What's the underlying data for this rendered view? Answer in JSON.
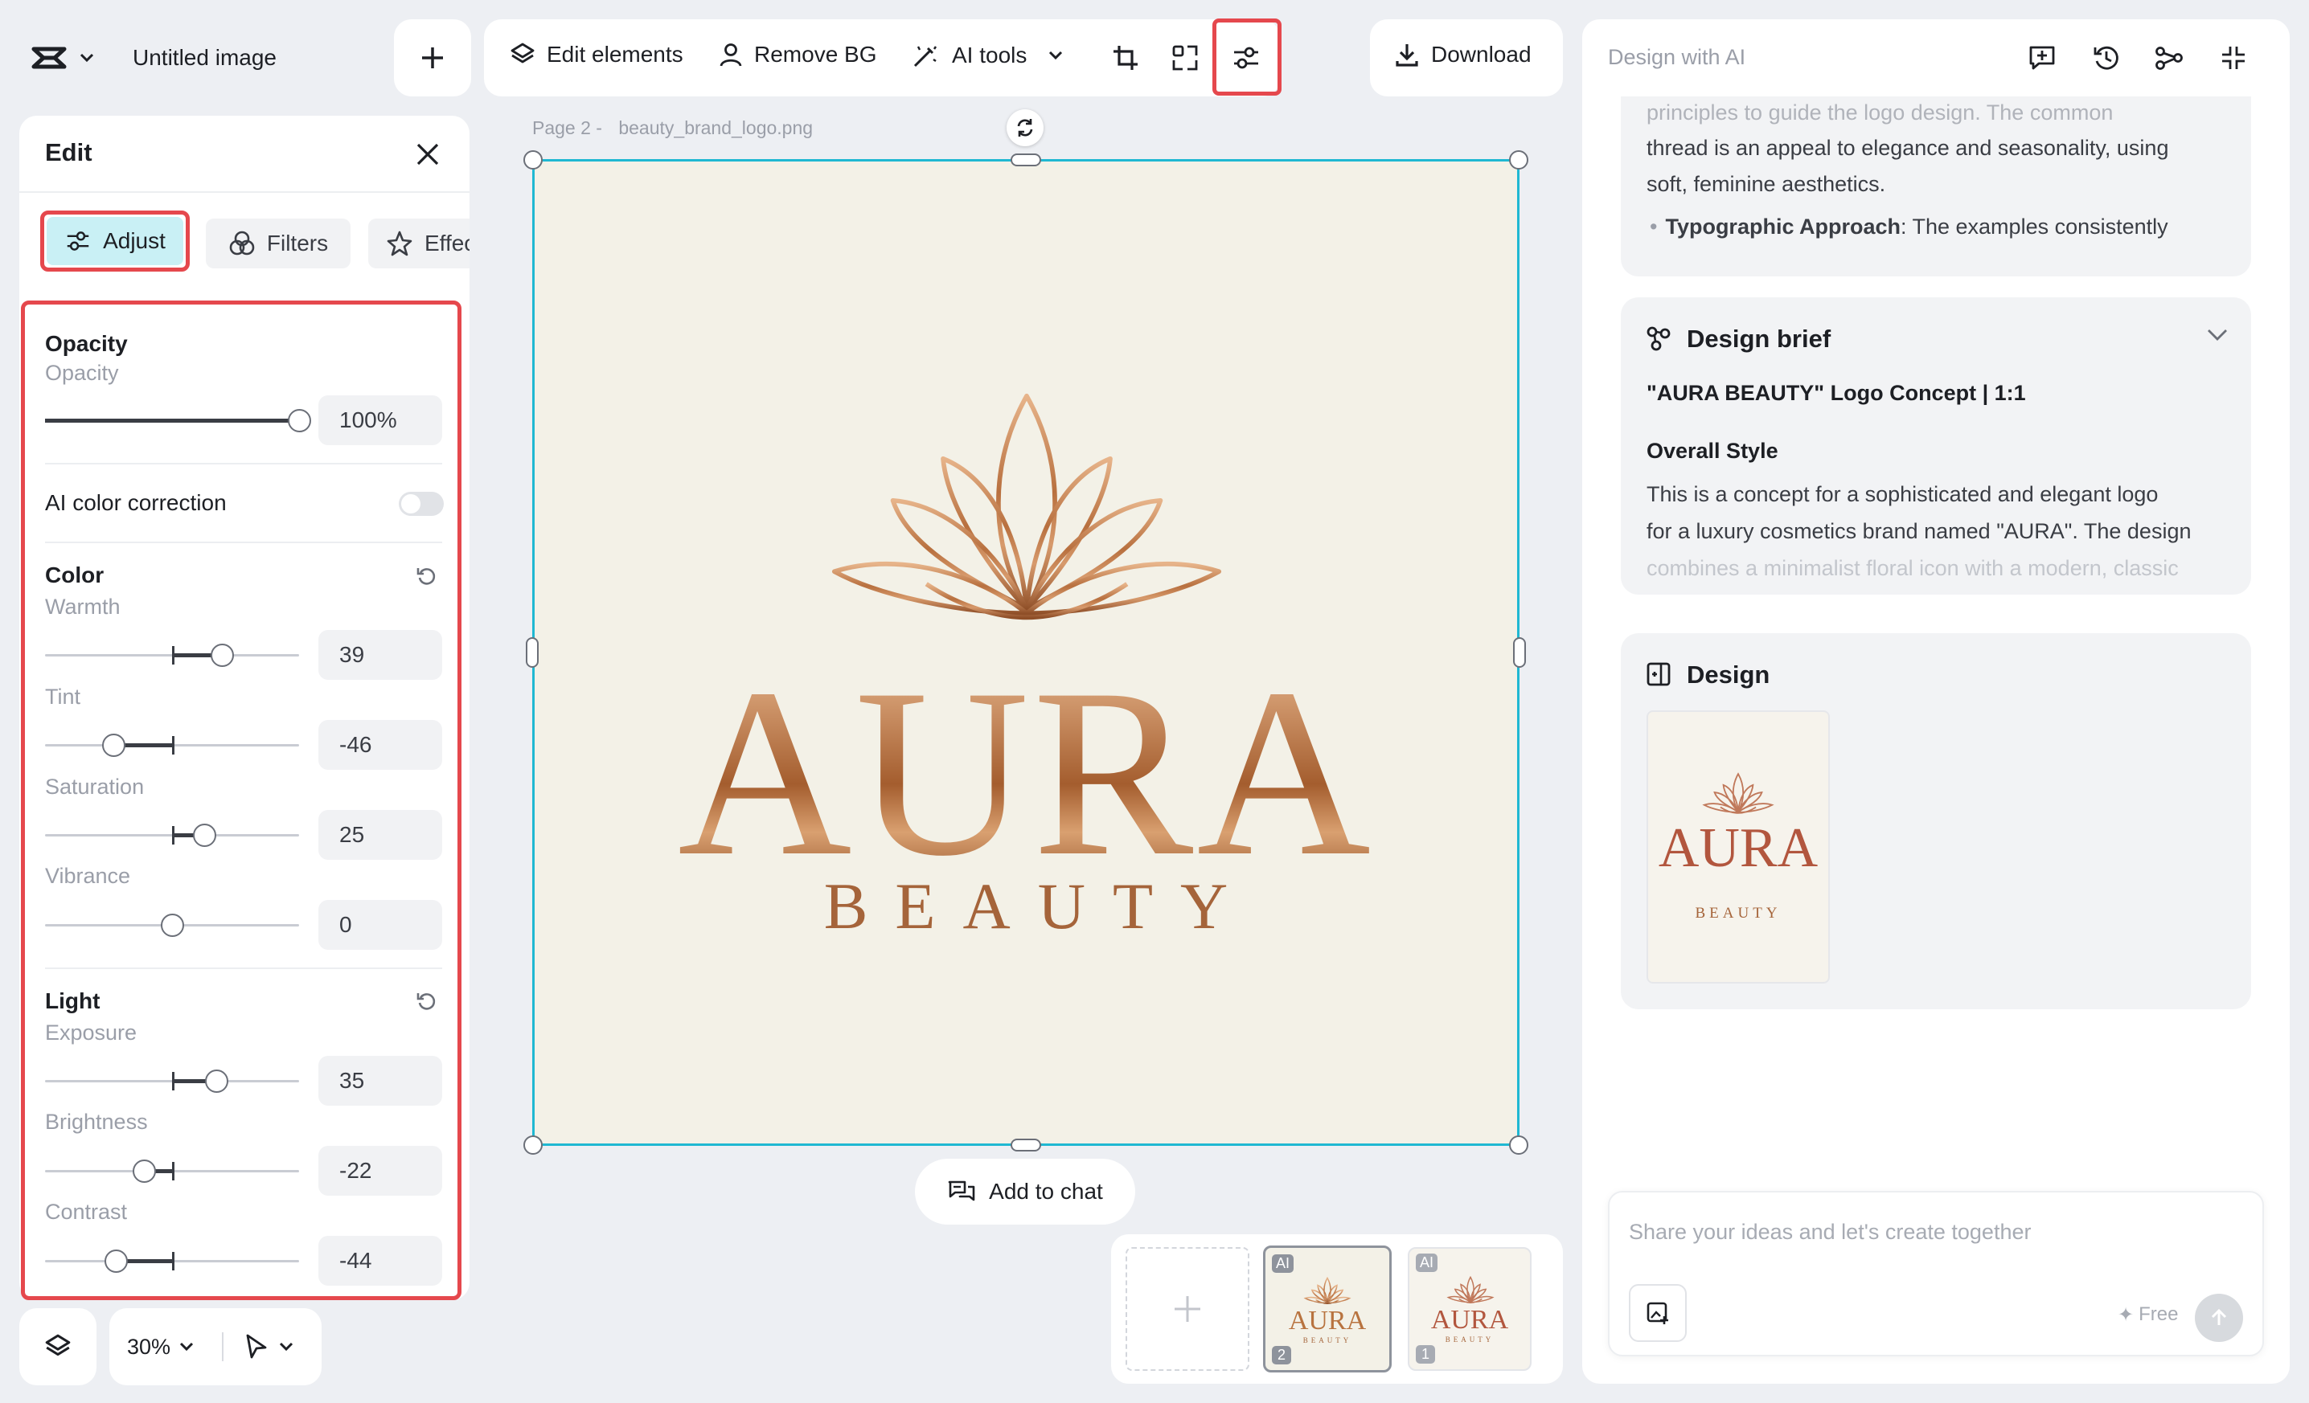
{
  "app": {
    "title": "Untitled image"
  },
  "toolbar": {
    "edit_elements": "Edit elements",
    "remove_bg": "Remove BG",
    "ai_tools": "AI tools",
    "download": "Download"
  },
  "edit_panel": {
    "title": "Edit",
    "tabs": [
      {
        "label": "Adjust",
        "active": true
      },
      {
        "label": "Filters",
        "active": false
      },
      {
        "label": "Effects",
        "active": false
      }
    ],
    "opacity": {
      "title": "Opacity",
      "label": "Opacity",
      "value": "100%",
      "level": 1.0
    },
    "ai_color_correction": {
      "label": "AI color correction",
      "enabled": false
    },
    "color": {
      "title": "Color",
      "sliders": [
        {
          "label": "Warmth",
          "value": "39"
        },
        {
          "label": "Tint",
          "value": "-46"
        },
        {
          "label": "Saturation",
          "value": "25"
        },
        {
          "label": "Vibrance",
          "value": "0"
        }
      ]
    },
    "light": {
      "title": "Light",
      "sliders": [
        {
          "label": "Exposure",
          "value": "35"
        },
        {
          "label": "Brightness",
          "value": "-22"
        },
        {
          "label": "Contrast",
          "value": "-44"
        }
      ]
    }
  },
  "bottom_left": {
    "zoom": "30%"
  },
  "canvas": {
    "page_label": "Page 2 -",
    "file_name": "beauty_brand_logo.png",
    "logo_title": "AURA",
    "logo_subtitle": "BEAUTY",
    "add_to_chat": "Add to chat"
  },
  "thumbnails": [
    {
      "badge": "AI",
      "number": "2",
      "title": "AURA",
      "subtitle": "BEAUTY",
      "selected": true
    },
    {
      "badge": "AI",
      "number": "1",
      "title": "AURA",
      "subtitle": "BEAUTY",
      "selected": false
    }
  ],
  "right_panel": {
    "title": "Design with AI",
    "summary_lines": [
      "principles to guide the logo design. The common",
      "thread is an appeal to elegance and seasonality, using",
      "soft, feminine aesthetics."
    ],
    "bullet_bold": "Typographic Approach",
    "bullet_rest": ": The examples consistently",
    "brief": {
      "title": "Design brief",
      "concept": "\"AURA BEAUTY\" Logo Concept | 1:1",
      "style_heading": "Overall Style",
      "lines": [
        "This is a concept for a sophisticated and elegant logo",
        "for a luxury cosmetics brand named \"AURA\". The design",
        "combines a minimalist floral icon with a modern, classic"
      ]
    },
    "design": {
      "title": "Design",
      "thumb_title": "AURA",
      "thumb_subtitle": "BEAUTY"
    },
    "chat": {
      "placeholder": "Share your ideas and let's create together",
      "free_label": "Free"
    }
  },
  "colors": {
    "accent_highlight": "#e5484d",
    "selection": "#1fb8d2",
    "logo_gold": "#c98a5a",
    "canvas_bg": "#f3f1e7"
  }
}
